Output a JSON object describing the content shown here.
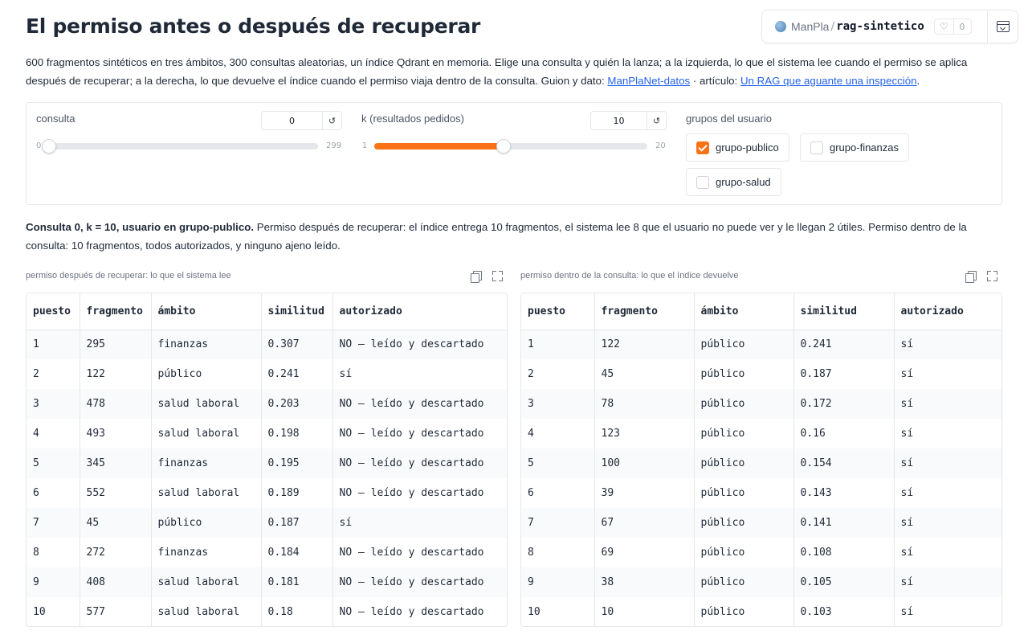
{
  "title": "El permiso antes o después de recuperar",
  "space": {
    "owner": "ManPla",
    "separator": "/",
    "repo": "rag-sintetico",
    "likes": "0"
  },
  "intro": {
    "text": "600 fragmentos sintéticos en tres ámbitos, 300 consultas aleatorias, un índice Qdrant en memoria. Elige una consulta y quién la lanza; a la izquierda, lo que el sistema lee cuando el permiso se aplica después de recuperar; a la derecha, lo que devuelve el índice cuando el permiso viaja dentro de la consulta. Guion y dato: ",
    "link1": "ManPlaNet-datos",
    "mid": " · artículo: ",
    "link2": "Un RAG que aguante una inspección",
    "end": "."
  },
  "controls": {
    "consulta": {
      "label": "consulta",
      "value": "0",
      "min": "0",
      "max": "299",
      "fraction": 0.0
    },
    "k": {
      "label": "k (resultados pedidos)",
      "value": "10",
      "min": "1",
      "max": "20",
      "fraction": 0.4737
    },
    "reset_glyph": "↺",
    "groups_label": "grupos del usuario",
    "groups": [
      {
        "label": "grupo-publico",
        "checked": true
      },
      {
        "label": "grupo-finanzas",
        "checked": false
      },
      {
        "label": "grupo-salud",
        "checked": false
      }
    ]
  },
  "summary": {
    "bold": "Consulta 0, k = 10, usuario en grupo-publico.",
    "rest": " Permiso después de recuperar: el índice entrega 10 fragmentos, el sistema lee 8 que el usuario no puede ver y le llegan 2 útiles. Permiso dentro de la consulta: 10 fragmentos, todos autorizados, y ninguno ajeno leído."
  },
  "columns": [
    "puesto",
    "fragmento",
    "ámbito",
    "similitud",
    "autorizado"
  ],
  "left_table": {
    "caption": "permiso después de recuperar: lo que el sistema lee",
    "rows": [
      [
        "1",
        "295",
        "finanzas",
        "0.307",
        "NO — leído y descartado"
      ],
      [
        "2",
        "122",
        "público",
        "0.241",
        "sí"
      ],
      [
        "3",
        "478",
        "salud laboral",
        "0.203",
        "NO — leído y descartado"
      ],
      [
        "4",
        "493",
        "salud laboral",
        "0.198",
        "NO — leído y descartado"
      ],
      [
        "5",
        "345",
        "finanzas",
        "0.195",
        "NO — leído y descartado"
      ],
      [
        "6",
        "552",
        "salud laboral",
        "0.189",
        "NO — leído y descartado"
      ],
      [
        "7",
        "45",
        "público",
        "0.187",
        "sí"
      ],
      [
        "8",
        "272",
        "finanzas",
        "0.184",
        "NO — leído y descartado"
      ],
      [
        "9",
        "408",
        "salud laboral",
        "0.181",
        "NO — leído y descartado"
      ],
      [
        "10",
        "577",
        "salud laboral",
        "0.18",
        "NO — leído y descartado"
      ]
    ]
  },
  "right_table": {
    "caption": "permiso dentro de la consulta: lo que el índice devuelve",
    "rows": [
      [
        "1",
        "122",
        "público",
        "0.241",
        "sí"
      ],
      [
        "2",
        "45",
        "público",
        "0.187",
        "sí"
      ],
      [
        "3",
        "78",
        "público",
        "0.172",
        "sí"
      ],
      [
        "4",
        "123",
        "público",
        "0.16",
        "sí"
      ],
      [
        "5",
        "100",
        "público",
        "0.154",
        "sí"
      ],
      [
        "6",
        "39",
        "público",
        "0.143",
        "sí"
      ],
      [
        "7",
        "67",
        "público",
        "0.141",
        "sí"
      ],
      [
        "8",
        "69",
        "público",
        "0.108",
        "sí"
      ],
      [
        "9",
        "38",
        "público",
        "0.105",
        "sí"
      ],
      [
        "10",
        "10",
        "público",
        "0.103",
        "sí"
      ]
    ]
  },
  "colors": {
    "accent": "#f97316",
    "link": "#2563eb"
  }
}
